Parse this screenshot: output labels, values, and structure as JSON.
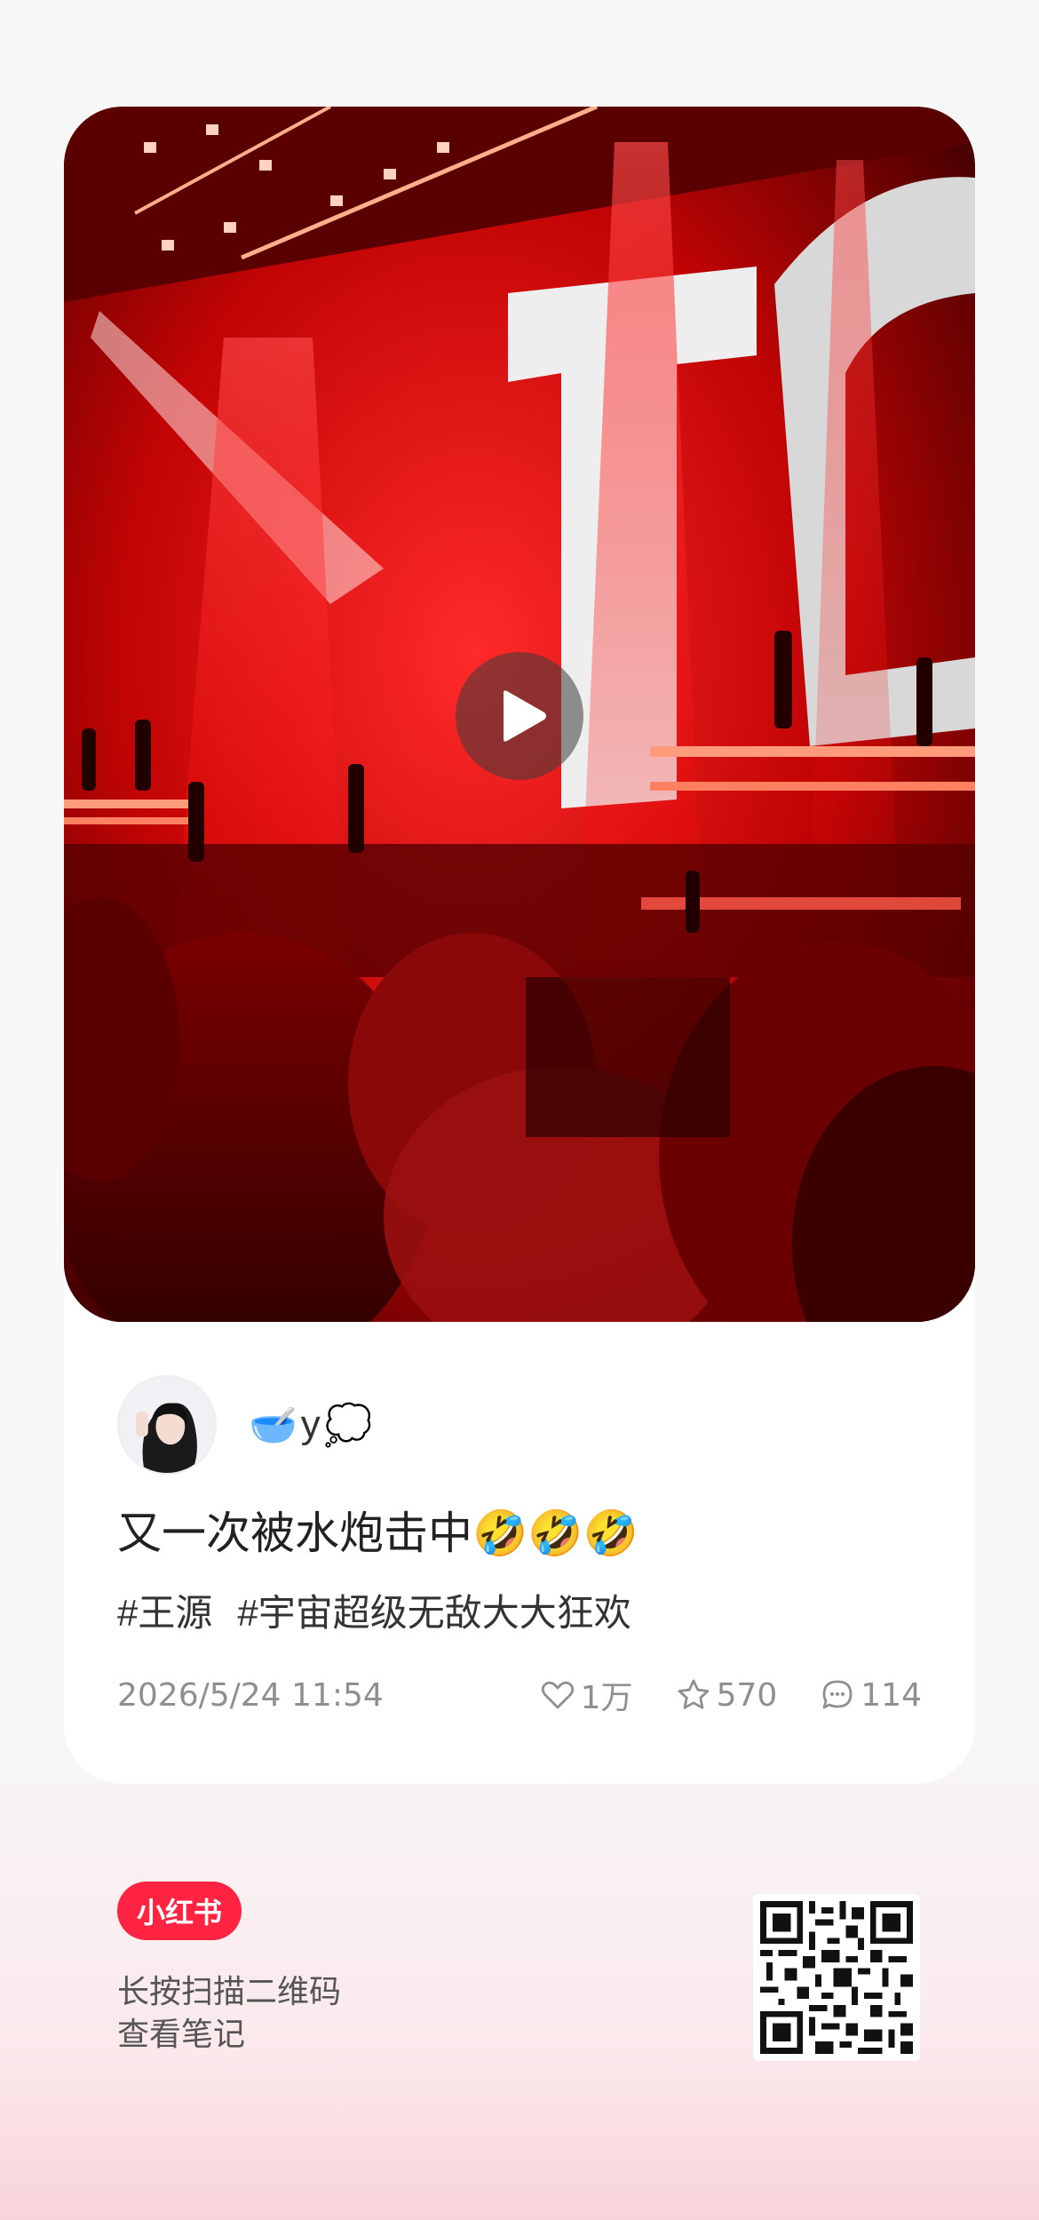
{
  "author": {
    "name": "y",
    "prefix_emoji": "🥣",
    "suffix_emoji": "💭"
  },
  "note": {
    "title": "又一次被水炮击中🤣🤣🤣",
    "tags": [
      "#王源",
      "#宇宙超级无敌大大狂欢"
    ],
    "date": "2026/5/24 11:54"
  },
  "stats": {
    "likes": "1万",
    "collects": "570",
    "comments": "114"
  },
  "icons": {
    "play": "play-icon",
    "like": "heart-icon",
    "collect": "star-icon",
    "comment": "comment-bubble-icon"
  },
  "footer": {
    "logo": "小红书",
    "line1": "长按扫描二维码",
    "line2": "查看笔记"
  },
  "colors": {
    "brand": "#ff2442",
    "muted": "#8f8f8f"
  }
}
